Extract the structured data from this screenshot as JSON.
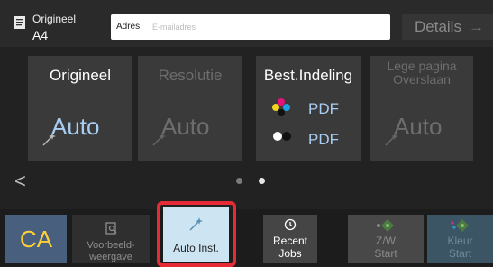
{
  "header": {
    "original_label": "Origineel",
    "original_size": "A4",
    "address_label": "Adres",
    "address_placeholder": "E-mailadres",
    "details_label": "Details",
    "details_arrow": "→"
  },
  "tiles": [
    {
      "title": "Origineel",
      "value": "Auto",
      "state": "active"
    },
    {
      "title": "Resolutie",
      "value": "Auto",
      "state": "disabled"
    },
    {
      "title": "Best.Indeling",
      "color_format": "PDF",
      "bw_format": "PDF",
      "state": "active"
    },
    {
      "title_line1": "Lege pagina",
      "title_line2": "Overslaan",
      "value": "Auto",
      "state": "disabled"
    }
  ],
  "pager": {
    "prev_symbol": "<",
    "pages": 2,
    "current": 2
  },
  "bottom": {
    "ca_label": "CA",
    "preview_line1": "Voorbeeld-",
    "preview_line2": "weergave",
    "auto_label": "Auto Inst.",
    "recent_line1": "Recent",
    "recent_line2": "Jobs",
    "zw_line1": "Z/W",
    "zw_line2": "Start",
    "kleur_line1": "Kleur",
    "kleur_line2": "Start"
  },
  "colors": {
    "highlight": "#e62b36",
    "ca_text": "#ffcf3a",
    "auto_value": "#a8cdf2",
    "auto_inst_bg": "#cde5f2"
  }
}
